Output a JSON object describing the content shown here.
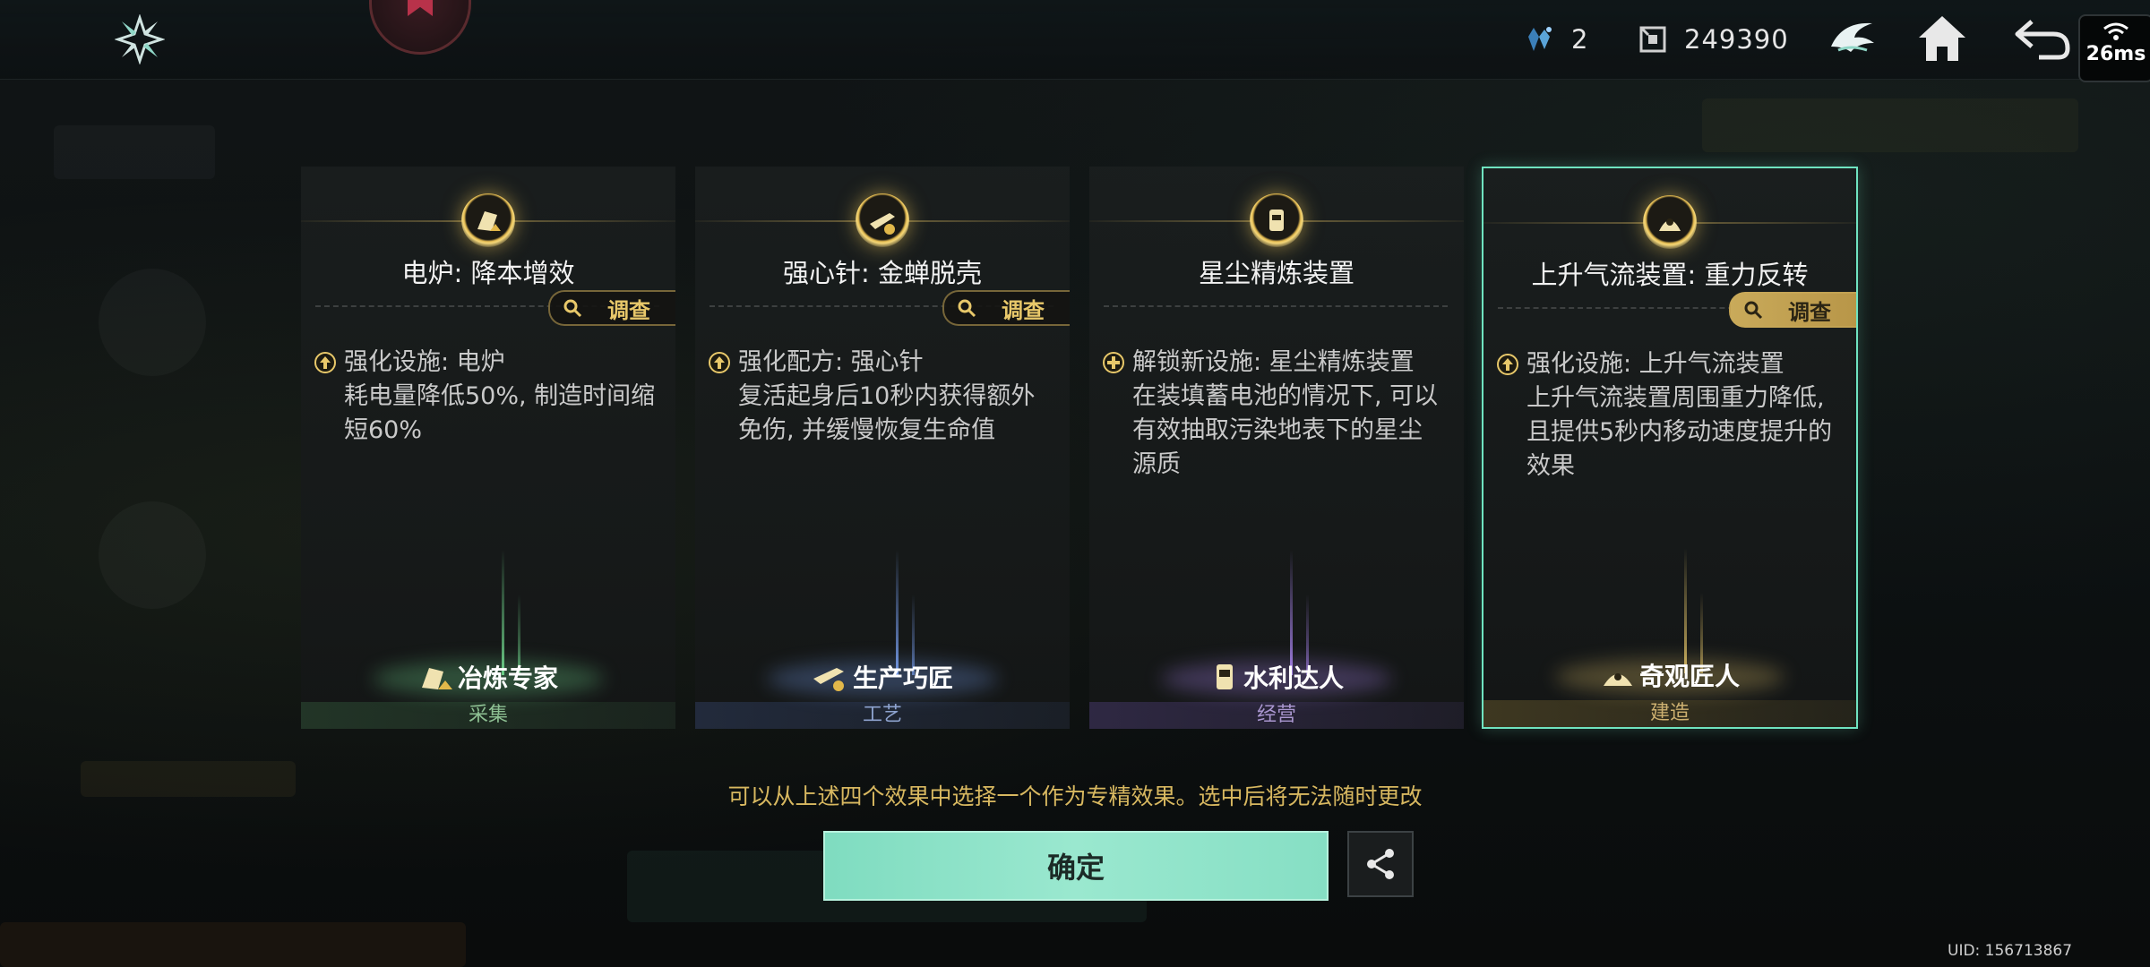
{
  "topbar": {
    "crystal_count": "2",
    "currency_amount": "249390",
    "ping": "26ms"
  },
  "cards": [
    {
      "title": "电炉: 降本增效",
      "investigate": "调查",
      "desc_head": "强化设施: 电炉",
      "desc_body": "耗电量降低50%, 制造时间缩短60%",
      "role": "冶炼专家",
      "category": "采集",
      "desc_icon": "upgrade-arrow-icon",
      "accent": "#78e696"
    },
    {
      "title": "强心针: 金蝉脱壳",
      "investigate": "调查",
      "desc_head": "强化配方: 强心针",
      "desc_body": "复活起身后10秒内获得额外免伤, 并缓慢恢复生命值",
      "role": "生产巧匠",
      "category": "工艺",
      "desc_icon": "upgrade-arrow-icon",
      "accent": "#7fa8ff"
    },
    {
      "title": "星尘精炼装置",
      "investigate": "",
      "desc_head": "解锁新设施: 星尘精炼装置",
      "desc_body": "在装填蓄电池的情况下, 可以有效抽取污染地表下的星尘源质",
      "role": "水利达人",
      "category": "经营",
      "desc_icon": "plus-icon",
      "accent": "#b48cff"
    },
    {
      "title": "上升气流装置: 重力反转",
      "investigate": "调查",
      "desc_head": "强化设施: 上升气流装置",
      "desc_body": "上升气流装置周围重力降低, 且提供5秒内移动速度提升的效果",
      "role": "奇观匠人",
      "category": "建造",
      "desc_icon": "upgrade-arrow-icon",
      "accent": "#e8c86a"
    }
  ],
  "hint": "可以从上述四个效果中选择一个作为专精效果。选中后将无法随时更改",
  "confirm_label": "确定",
  "uid": "UID: 156713867"
}
